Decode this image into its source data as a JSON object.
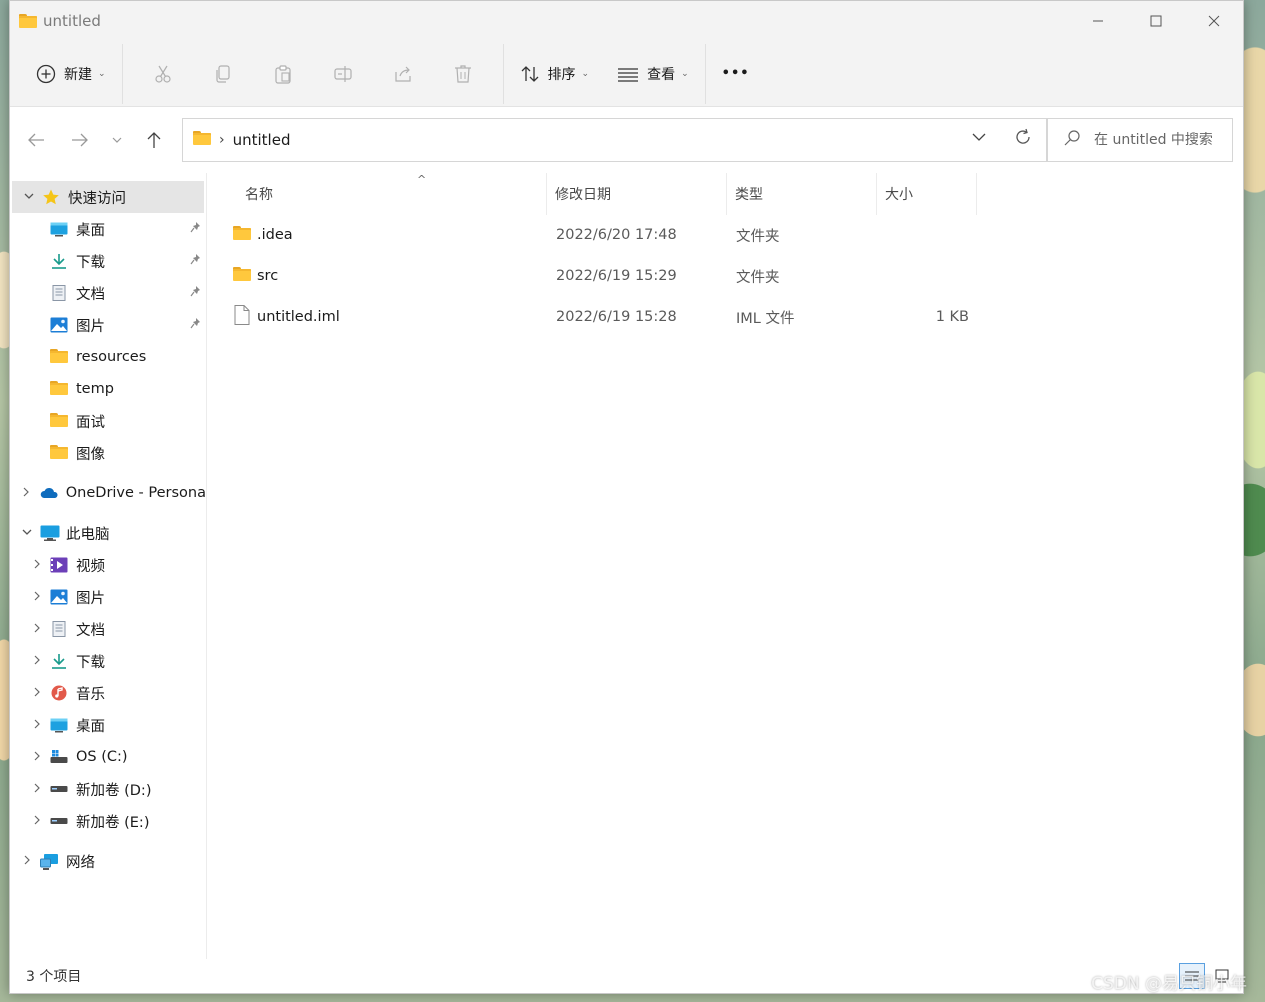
{
  "window": {
    "title": "untitled"
  },
  "toolbar": {
    "new_label": "新建",
    "sort_label": "排序",
    "view_label": "查看",
    "more_label": "•••"
  },
  "address": {
    "path": "untitled",
    "search_placeholder": "在 untitled 中搜索"
  },
  "nav": {
    "quick_access": "快速访问",
    "quick_items": [
      {
        "label": "桌面",
        "icon": "desktop-icon",
        "pinned": true
      },
      {
        "label": "下载",
        "icon": "download-icon",
        "pinned": true
      },
      {
        "label": "文档",
        "icon": "document-icon",
        "pinned": true
      },
      {
        "label": "图片",
        "icon": "pictures-icon",
        "pinned": true
      },
      {
        "label": "resources",
        "icon": "folder-icon",
        "pinned": false
      },
      {
        "label": "temp",
        "icon": "folder-icon",
        "pinned": false
      },
      {
        "label": "面试",
        "icon": "folder-icon",
        "pinned": false
      },
      {
        "label": "图像",
        "icon": "folder-icon",
        "pinned": false
      }
    ],
    "onedrive": "OneDrive - Persona",
    "this_pc": "此电脑",
    "pc_items": [
      {
        "label": "视频",
        "icon": "videos-icon"
      },
      {
        "label": "图片",
        "icon": "pictures-icon"
      },
      {
        "label": "文档",
        "icon": "document-icon"
      },
      {
        "label": "下载",
        "icon": "download-icon"
      },
      {
        "label": "音乐",
        "icon": "music-icon"
      },
      {
        "label": "桌面",
        "icon": "desktop-icon"
      },
      {
        "label": "OS (C:)",
        "icon": "os-drive-icon"
      },
      {
        "label": "新加卷 (D:)",
        "icon": "drive-icon"
      },
      {
        "label": "新加卷 (E:)",
        "icon": "drive-icon"
      }
    ],
    "network": "网络"
  },
  "columns": {
    "name": "名称",
    "date": "修改日期",
    "type": "类型",
    "size": "大小"
  },
  "files": [
    {
      "name": ".idea",
      "date": "2022/6/20 17:48",
      "type": "文件夹",
      "size": "",
      "icon": "folder-icon"
    },
    {
      "name": "src",
      "date": "2022/6/19 15:29",
      "type": "文件夹",
      "size": "",
      "icon": "folder-icon"
    },
    {
      "name": "untitled.iml",
      "date": "2022/6/19 15:28",
      "type": "IML 文件",
      "size": "1 KB",
      "icon": "file-icon"
    }
  ],
  "status": {
    "item_count": "3 个项目"
  },
  "watermark": "CSDN @易只铜小年"
}
